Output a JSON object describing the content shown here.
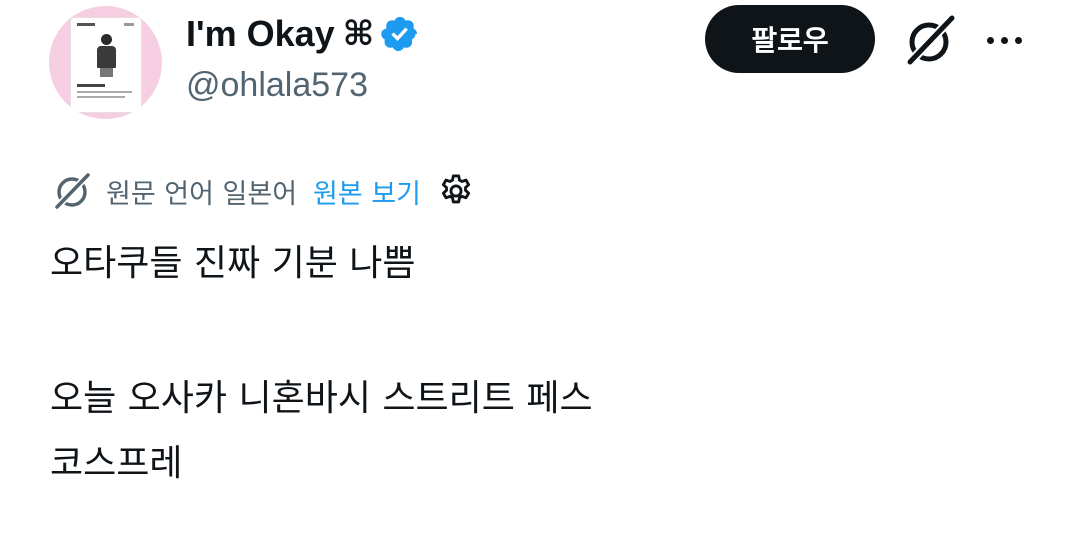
{
  "profile": {
    "display_name": "I'm Okay",
    "name_symbol": "⌘",
    "handle": "@ohlala573",
    "verified": true,
    "avatar_bg": "#f5cfe1",
    "verified_color": "#1d9bf0"
  },
  "actions": {
    "follow_label": "팔로우",
    "grok_icon": "grok-icon",
    "more_icon": "more-icon"
  },
  "translation": {
    "label": "원문 언어 일본어",
    "show_original": "원본 보기",
    "link_color": "#1d9bf0"
  },
  "tweet": {
    "lines": [
      "오타쿠들 진짜 기분 나쁨",
      "오늘 오사카 니혼바시 스트리트 페스",
      "코스프레"
    ]
  }
}
